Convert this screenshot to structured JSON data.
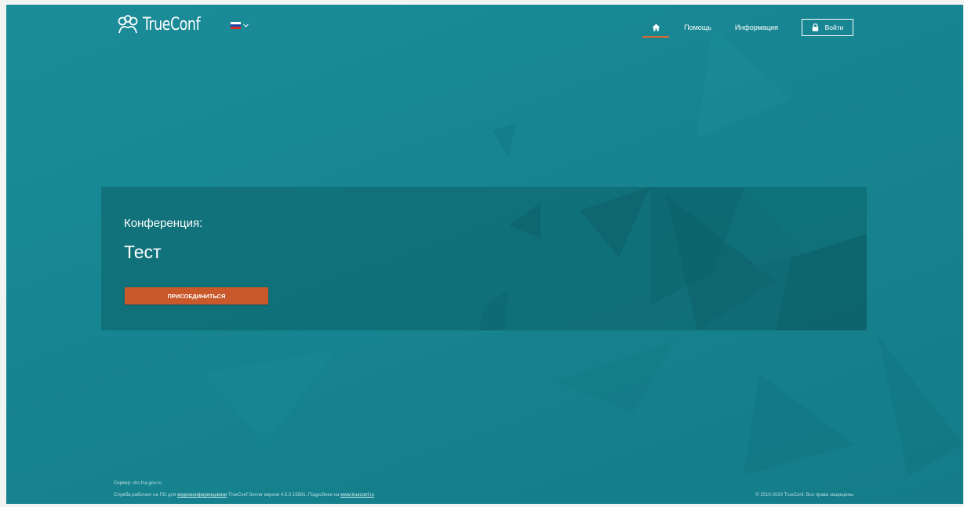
{
  "header": {
    "logo_text": "TrueConf",
    "language_flag_colors": [
      "#ffffff",
      "#2446a8",
      "#d62b2b"
    ],
    "nav": {
      "home_icon": "home-icon",
      "help_label": "Помощь",
      "info_label": "Информация",
      "login_label": "Войти",
      "login_icon": "lock-icon"
    }
  },
  "conference": {
    "label": "Конференция:",
    "name": "Тест",
    "join_button_label": "ПРИСОЕДИНИТЬСЯ"
  },
  "footer": {
    "server": "Сервер: vks.fsa.gov.ru",
    "service_prefix": "Служба работает на ПО для ",
    "service_link": "видеоконференцсвязи",
    "service_middle": " TrueConf Server версии 4.5.0.15891. Подробнее на ",
    "site_link": "www.trueconf.ru",
    "copyright": "© 2010-2020 TrueConf. Все права защищены"
  },
  "colors": {
    "background": "#178591",
    "accent": "#d96a2b",
    "join_button": "#c9582a"
  }
}
